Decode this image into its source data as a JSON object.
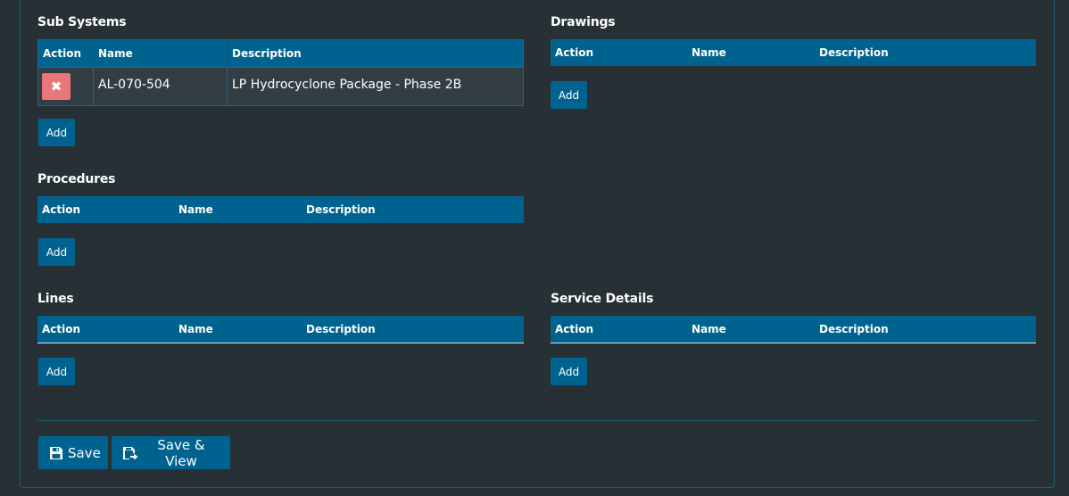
{
  "sub_systems": {
    "title": "Sub Systems",
    "columns": [
      "Action",
      "Name",
      "Description"
    ],
    "rows": [
      {
        "action_icon": "times-icon",
        "action_glyph": "✖",
        "name": "AL-070-504",
        "description": "LP Hydrocyclone Package - Phase 2B"
      }
    ],
    "add_label": "Add"
  },
  "drawings": {
    "title": "Drawings",
    "columns": [
      "Action",
      "Name",
      "Description"
    ],
    "add_label": "Add"
  },
  "procedures": {
    "title": "Procedures",
    "columns": [
      "Action",
      "Name",
      "Description"
    ],
    "add_label": "Add"
  },
  "lines": {
    "title": "Lines",
    "columns": [
      "Action",
      "Name",
      "Description"
    ],
    "add_label": "Add"
  },
  "service_details": {
    "title": "Service Details",
    "columns": [
      "Action",
      "Name",
      "Description"
    ],
    "add_label": "Add"
  },
  "footer": {
    "save_label": "Save",
    "save_icon": "floppy-disk-icon",
    "save_view_label": "Save & View",
    "save_view_icon": "save-arrow-icon"
  },
  "colors": {
    "background": "#263035",
    "header": "#00638f",
    "delete_button": "#e8767a",
    "row": "#323e43"
  }
}
